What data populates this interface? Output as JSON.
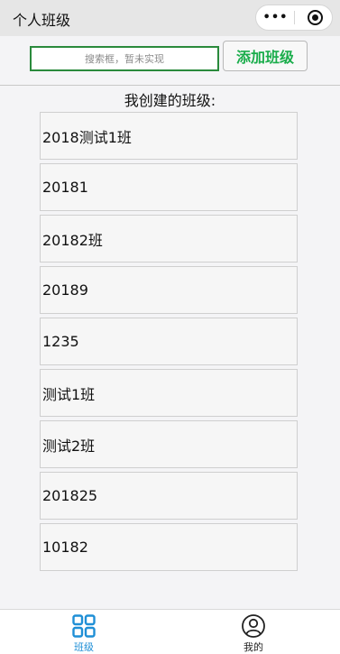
{
  "navbar": {
    "title": "个人班级",
    "more_label": "•••"
  },
  "search": {
    "placeholder": "搜索框，暂未实现"
  },
  "toolbar": {
    "add_label": "添加班级"
  },
  "section": {
    "title": "我创建的班级:"
  },
  "classes": [
    {
      "name": "2018测试1班"
    },
    {
      "name": "20181"
    },
    {
      "name": "20182班"
    },
    {
      "name": "20189"
    },
    {
      "name": "1235"
    },
    {
      "name": "测试1班"
    },
    {
      "name": "测试2班"
    },
    {
      "name": "201825"
    },
    {
      "name": "10182"
    }
  ],
  "tabbar": {
    "items": [
      {
        "label": "班级",
        "icon": "grid-icon",
        "active": true,
        "color": "#1f8fd6"
      },
      {
        "label": "我的",
        "icon": "user-icon",
        "active": false,
        "color": "#222222"
      }
    ]
  },
  "colors": {
    "accent_green": "#1aad4b",
    "search_border": "#2a8a3c",
    "tab_active": "#1f8fd6"
  }
}
